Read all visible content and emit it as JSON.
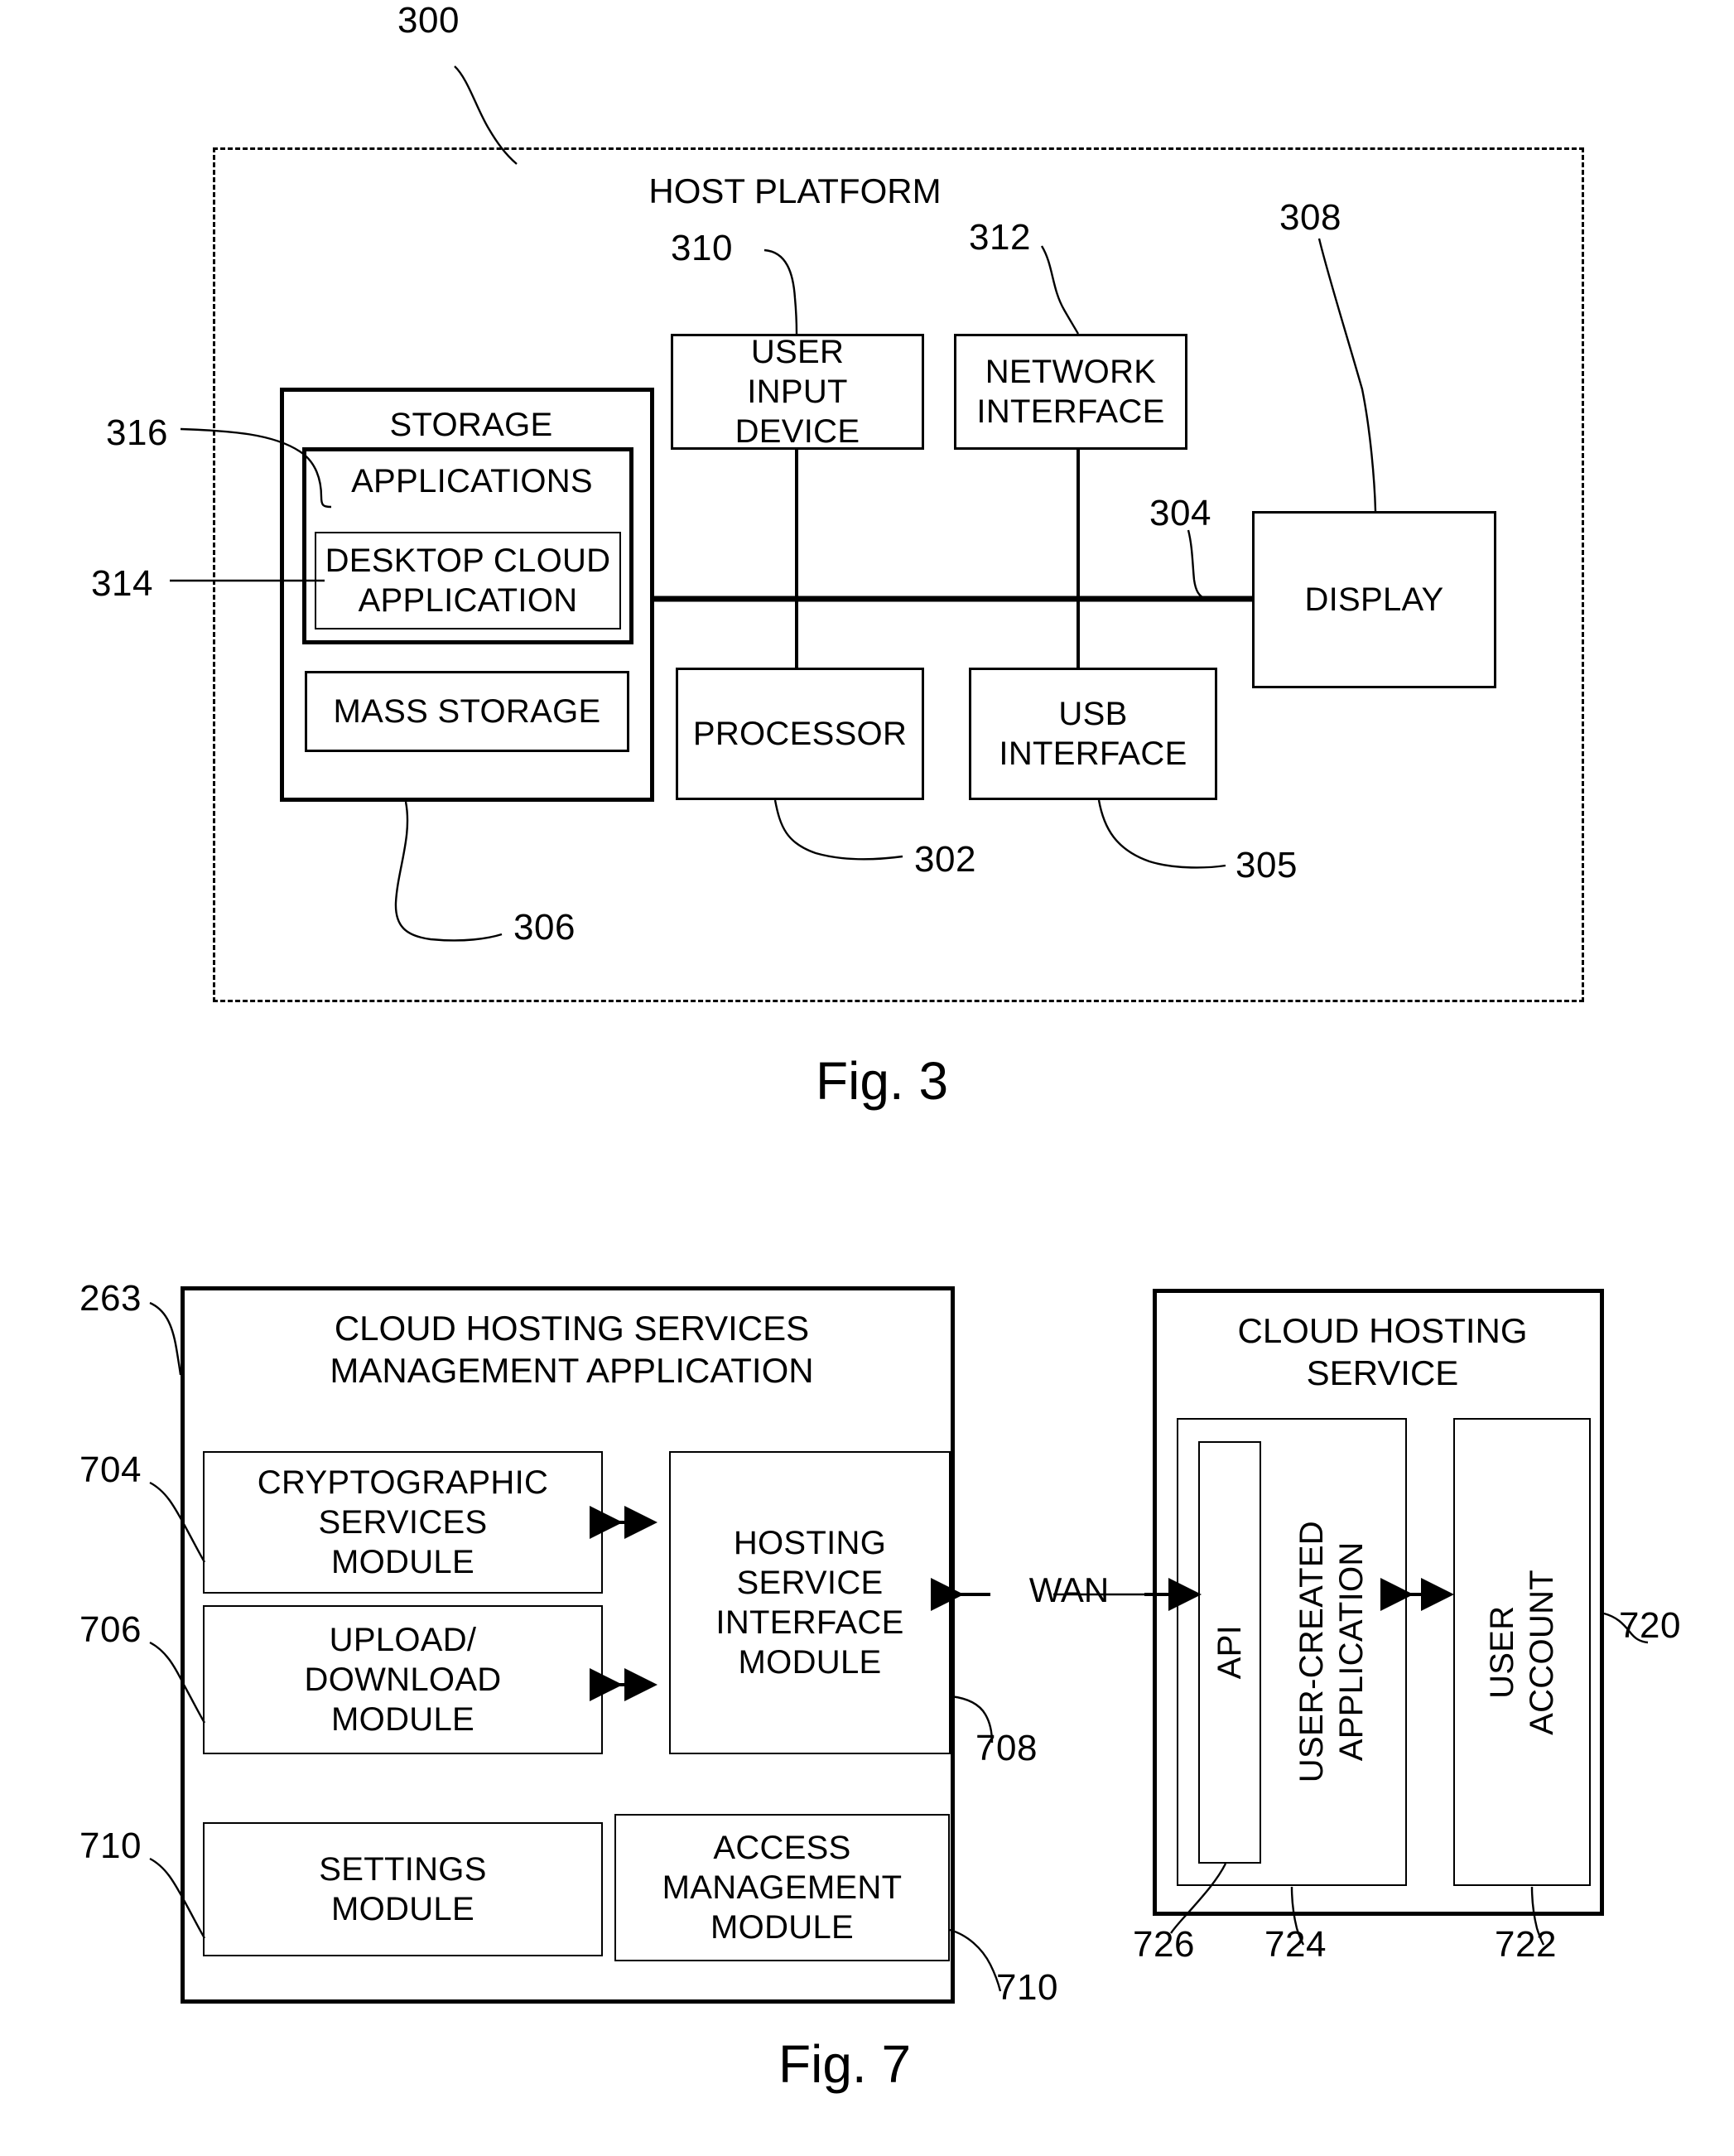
{
  "figures": [
    {
      "id": "fig3",
      "caption": "Fig. 3",
      "outer_ref": "300",
      "title": "HOST PLATFORM",
      "blocks": {
        "storage": "STORAGE",
        "applications": "APPLICATIONS",
        "desktop_cloud_application": "DESKTOP CLOUD\nAPPLICATION",
        "mass_storage": "MASS STORAGE",
        "user_input_device": "USER\nINPUT\nDEVICE",
        "network_interface": "NETWORK\nINTERFACE",
        "display": "DISPLAY",
        "processor": "PROCESSOR",
        "usb_interface": "USB\nINTERFACE"
      },
      "refs": {
        "storage": "306",
        "applications": "316",
        "desktop_cloud_application": "314",
        "user_input_device": "310",
        "network_interface": "312",
        "display": "308",
        "processor": "302",
        "usb_interface": "305",
        "bus": "304"
      }
    },
    {
      "id": "fig7",
      "caption": "Fig. 7",
      "left_panel": {
        "title": "CLOUD HOSTING SERVICES\nMANAGEMENT APPLICATION",
        "ref": "263",
        "modules": [
          {
            "label": "CRYPTOGRAPHIC\nSERVICES\nMODULE",
            "ref": "704"
          },
          {
            "label": "UPLOAD/\nDOWNLOAD\nMODULE",
            "ref": "706"
          },
          {
            "label": "HOSTING\nSERVICE\nINTERFACE\nMODULE",
            "ref": "708"
          },
          {
            "label": "SETTINGS\nMODULE",
            "ref": "710"
          },
          {
            "label": "ACCESS\nMANAGEMENT\nMODULE",
            "ref": "710"
          }
        ]
      },
      "link": {
        "label": "WAN"
      },
      "right_panel": {
        "title": "CLOUD HOSTING\nSERVICE",
        "ref": "720",
        "modules": [
          {
            "label": "USER-CREATED\nAPPLICATION",
            "ref": "724"
          },
          {
            "label": "API",
            "ref": "726"
          },
          {
            "label": "USER\nACCOUNT",
            "ref": "722"
          }
        ]
      }
    }
  ]
}
